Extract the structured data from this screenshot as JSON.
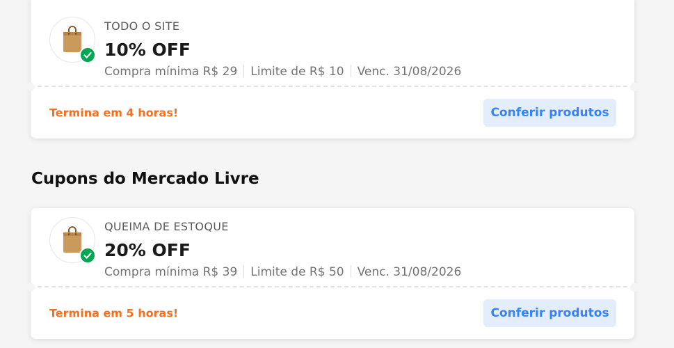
{
  "section_title": "Cupons do Mercado Livre",
  "colors": {
    "accent_blue": "#3483fa",
    "button_bg": "#e3edfb",
    "urgent_orange": "#f37021",
    "check_green": "#00a650"
  },
  "coupons": [
    {
      "icon": "shopping-bag-icon",
      "label": "TODO O SITE",
      "discount": "10% OFF",
      "min_purchase": "Compra mínima R$ 29",
      "limit": "Limite de R$ 10",
      "expiration": "Venc. 31/08/2026",
      "countdown": "Termina em 4 horas!",
      "button_label": "Conferir produtos"
    },
    {
      "icon": "shopping-bag-icon",
      "label": "QUEIMA DE ESTOQUE",
      "discount": "20% OFF",
      "min_purchase": "Compra mínima R$ 39",
      "limit": "Limite de R$ 50",
      "expiration": "Venc. 31/08/2026",
      "countdown": "Termina em 5 horas!",
      "button_label": "Conferir produtos"
    }
  ]
}
